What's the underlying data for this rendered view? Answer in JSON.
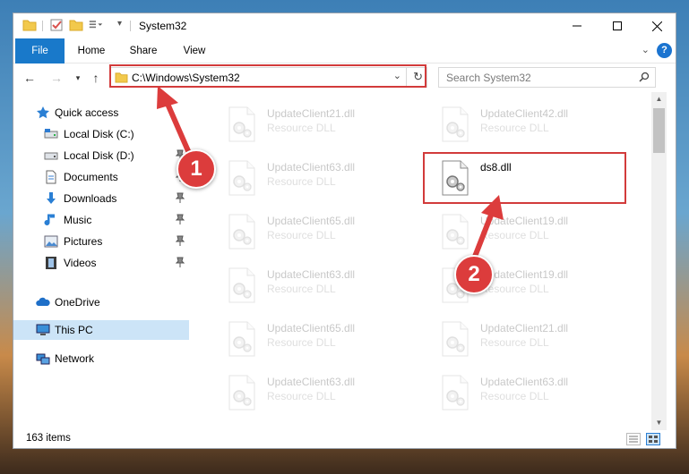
{
  "window": {
    "title": "System32"
  },
  "ribbon": {
    "tabs": [
      "File",
      "Home",
      "Share",
      "View"
    ]
  },
  "address": {
    "path": "C:\\Windows\\System32",
    "search_placeholder": "Search System32"
  },
  "sidebar": {
    "items": [
      {
        "label": "Quick access",
        "icon": "star-icon"
      },
      {
        "label": "Local Disk (C:)",
        "icon": "drive-icon"
      },
      {
        "label": "Local Disk (D:)",
        "icon": "drive-icon"
      },
      {
        "label": "Documents",
        "icon": "documents-icon"
      },
      {
        "label": "Downloads",
        "icon": "downloads-icon"
      },
      {
        "label": "Music",
        "icon": "music-icon"
      },
      {
        "label": "Pictures",
        "icon": "pictures-icon"
      },
      {
        "label": "Videos",
        "icon": "videos-icon"
      },
      {
        "label": "OneDrive",
        "icon": "onedrive-icon"
      },
      {
        "label": "This PC",
        "icon": "computer-icon",
        "selected": true
      },
      {
        "label": "Network",
        "icon": "network-icon"
      }
    ]
  },
  "files": {
    "left": [
      {
        "name": "UpdateClient21.dll",
        "type": "Resource DLL"
      },
      {
        "name": "UpdateClient63.dll",
        "type": "Resource DLL"
      },
      {
        "name": "UpdateClient65.dll",
        "type": "Resource DLL"
      },
      {
        "name": "UpdateClient63.dll",
        "type": "Resource DLL"
      },
      {
        "name": "UpdateClient65.dll",
        "type": "Resource DLL"
      },
      {
        "name": "UpdateClient63.dll",
        "type": "Resource DLL"
      }
    ],
    "right": [
      {
        "name": "UpdateClient42.dll",
        "type": "Resource DLL"
      },
      {
        "name": "ds8.dll",
        "type": ""
      },
      {
        "name": "UpdateClient19.dll",
        "type": "Resource DLL"
      },
      {
        "name": "UpdateClient19.dll",
        "type": "Resource DLL"
      },
      {
        "name": "UpdateClient21.dll",
        "type": "Resource DLL"
      },
      {
        "name": "UpdateClient63.dll",
        "type": "Resource DLL"
      }
    ]
  },
  "status": {
    "item_count": "163 items"
  },
  "annotations": {
    "step1": "1",
    "step2": "2"
  },
  "colors": {
    "accent": "#1979ca",
    "highlight": "#d23b3b",
    "selected": "#cce4f7"
  }
}
